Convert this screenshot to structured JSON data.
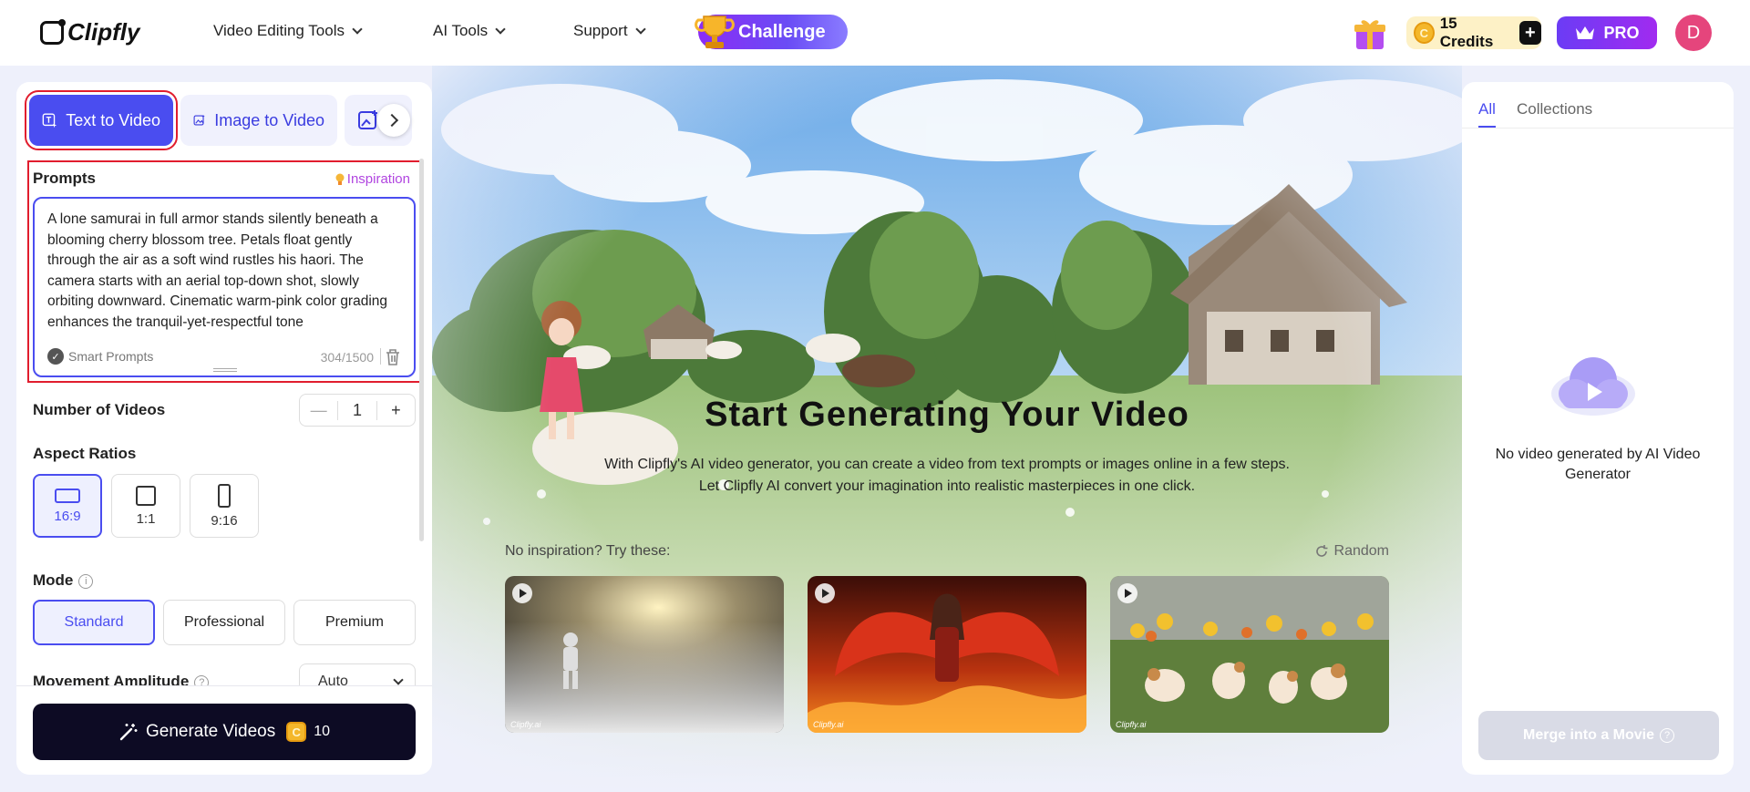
{
  "header": {
    "logo": "Clipfly",
    "nav": [
      {
        "label": "Video Editing Tools"
      },
      {
        "label": "AI Tools"
      },
      {
        "label": "Support"
      }
    ],
    "challenge": "Challenge",
    "credits_label": "15 Credits",
    "coin_symbol": "C",
    "plus": "+",
    "pro": "PRO",
    "avatar_initial": "D"
  },
  "left": {
    "tabs": [
      {
        "label": "Text to Video"
      },
      {
        "label": "Image to Video"
      }
    ],
    "prompts_label": "Prompts",
    "inspiration": "Inspiration",
    "prompt_text": "A lone samurai in full armor stands silently beneath a blooming cherry blossom tree. Petals float gently through the air as a soft wind rustles his haori. The camera starts with an aerial top-down shot, slowly orbiting downward. Cinematic warm-pink color grading enhances the tranquil-yet-respectful tone",
    "smart_prompts": "Smart Prompts",
    "counter": "304/1500",
    "num_videos_label": "Number of Videos",
    "num_videos_value": "1",
    "minus": "—",
    "plus": "+",
    "aspect_label": "Aspect Ratios",
    "ratios": [
      {
        "label": "16:9",
        "selected": true
      },
      {
        "label": "1:1",
        "selected": false
      },
      {
        "label": "9:16",
        "selected": false
      }
    ],
    "mode_label": "Mode",
    "modes": [
      {
        "label": "Standard",
        "selected": true
      },
      {
        "label": "Professional",
        "selected": false
      },
      {
        "label": "Premium",
        "selected": false
      }
    ],
    "movement_label": "Movement Amplitude",
    "movement_value": "Auto",
    "info_glyph": "i",
    "help_glyph": "?",
    "generate_label": "Generate Videos",
    "generate_cost": "10"
  },
  "center": {
    "title": "Start Generating Your Video",
    "subtitle": "With Clipfly's AI video generator, you can create a video from text prompts or images online in a few steps. Let Clipfly AI convert your imagination into realistic masterpieces in one click.",
    "try_label": "No inspiration? Try these:",
    "random_label": "Random",
    "watermark": "Clipfly.ai",
    "thumbnails": [
      {
        "subject": "astronaut-in-fog"
      },
      {
        "subject": "winged-warrior-in-fire"
      },
      {
        "subject": "puppies-on-grass"
      }
    ]
  },
  "right": {
    "tabs": [
      {
        "label": "All",
        "active": true
      },
      {
        "label": "Collections",
        "active": false
      }
    ],
    "empty_text": "No video generated by AI Video Generator",
    "merge_label": "Merge into a Movie"
  },
  "colors": {
    "accent": "#4a4df0",
    "highlight_outline": "#e11d2e",
    "generate_bg": "#0d0b24",
    "avatar": "#e5457c"
  }
}
